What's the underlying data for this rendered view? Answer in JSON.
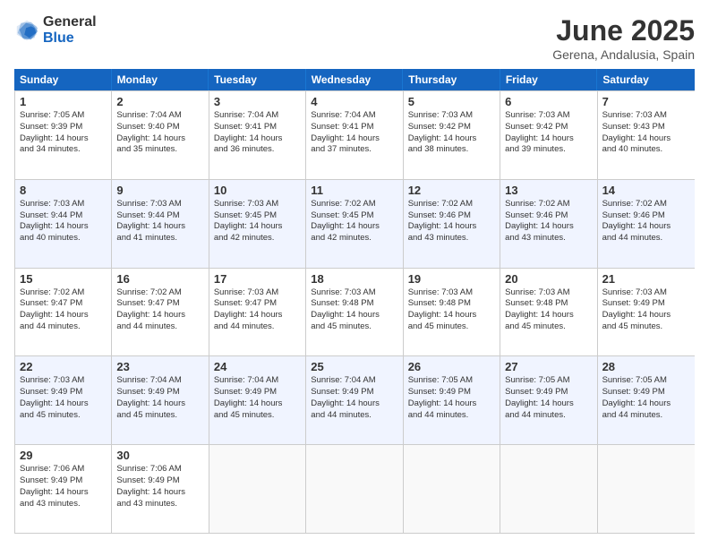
{
  "logo": {
    "general": "General",
    "blue": "Blue"
  },
  "title": "June 2025",
  "subtitle": "Gerena, Andalusia, Spain",
  "headers": [
    "Sunday",
    "Monday",
    "Tuesday",
    "Wednesday",
    "Thursday",
    "Friday",
    "Saturday"
  ],
  "rows": [
    [
      {
        "day": "",
        "empty": true
      },
      {
        "day": "",
        "empty": true
      },
      {
        "day": "",
        "empty": true
      },
      {
        "day": "",
        "empty": true
      },
      {
        "day": "",
        "empty": true
      },
      {
        "day": "",
        "empty": true
      },
      {
        "day": "",
        "empty": true
      }
    ],
    [
      {
        "day": "1",
        "lines": [
          "Sunrise: 7:05 AM",
          "Sunset: 9:39 PM",
          "Daylight: 14 hours",
          "and 34 minutes."
        ]
      },
      {
        "day": "2",
        "lines": [
          "Sunrise: 7:04 AM",
          "Sunset: 9:40 PM",
          "Daylight: 14 hours",
          "and 35 minutes."
        ]
      },
      {
        "day": "3",
        "lines": [
          "Sunrise: 7:04 AM",
          "Sunset: 9:41 PM",
          "Daylight: 14 hours",
          "and 36 minutes."
        ]
      },
      {
        "day": "4",
        "lines": [
          "Sunrise: 7:04 AM",
          "Sunset: 9:41 PM",
          "Daylight: 14 hours",
          "and 37 minutes."
        ]
      },
      {
        "day": "5",
        "lines": [
          "Sunrise: 7:03 AM",
          "Sunset: 9:42 PM",
          "Daylight: 14 hours",
          "and 38 minutes."
        ]
      },
      {
        "day": "6",
        "lines": [
          "Sunrise: 7:03 AM",
          "Sunset: 9:42 PM",
          "Daylight: 14 hours",
          "and 39 minutes."
        ]
      },
      {
        "day": "7",
        "lines": [
          "Sunrise: 7:03 AM",
          "Sunset: 9:43 PM",
          "Daylight: 14 hours",
          "and 40 minutes."
        ]
      }
    ],
    [
      {
        "day": "8",
        "lines": [
          "Sunrise: 7:03 AM",
          "Sunset: 9:44 PM",
          "Daylight: 14 hours",
          "and 40 minutes."
        ]
      },
      {
        "day": "9",
        "lines": [
          "Sunrise: 7:03 AM",
          "Sunset: 9:44 PM",
          "Daylight: 14 hours",
          "and 41 minutes."
        ]
      },
      {
        "day": "10",
        "lines": [
          "Sunrise: 7:03 AM",
          "Sunset: 9:45 PM",
          "Daylight: 14 hours",
          "and 42 minutes."
        ]
      },
      {
        "day": "11",
        "lines": [
          "Sunrise: 7:02 AM",
          "Sunset: 9:45 PM",
          "Daylight: 14 hours",
          "and 42 minutes."
        ]
      },
      {
        "day": "12",
        "lines": [
          "Sunrise: 7:02 AM",
          "Sunset: 9:46 PM",
          "Daylight: 14 hours",
          "and 43 minutes."
        ]
      },
      {
        "day": "13",
        "lines": [
          "Sunrise: 7:02 AM",
          "Sunset: 9:46 PM",
          "Daylight: 14 hours",
          "and 43 minutes."
        ]
      },
      {
        "day": "14",
        "lines": [
          "Sunrise: 7:02 AM",
          "Sunset: 9:46 PM",
          "Daylight: 14 hours",
          "and 44 minutes."
        ]
      }
    ],
    [
      {
        "day": "15",
        "lines": [
          "Sunrise: 7:02 AM",
          "Sunset: 9:47 PM",
          "Daylight: 14 hours",
          "and 44 minutes."
        ]
      },
      {
        "day": "16",
        "lines": [
          "Sunrise: 7:02 AM",
          "Sunset: 9:47 PM",
          "Daylight: 14 hours",
          "and 44 minutes."
        ]
      },
      {
        "day": "17",
        "lines": [
          "Sunrise: 7:03 AM",
          "Sunset: 9:47 PM",
          "Daylight: 14 hours",
          "and 44 minutes."
        ]
      },
      {
        "day": "18",
        "lines": [
          "Sunrise: 7:03 AM",
          "Sunset: 9:48 PM",
          "Daylight: 14 hours",
          "and 45 minutes."
        ]
      },
      {
        "day": "19",
        "lines": [
          "Sunrise: 7:03 AM",
          "Sunset: 9:48 PM",
          "Daylight: 14 hours",
          "and 45 minutes."
        ]
      },
      {
        "day": "20",
        "lines": [
          "Sunrise: 7:03 AM",
          "Sunset: 9:48 PM",
          "Daylight: 14 hours",
          "and 45 minutes."
        ]
      },
      {
        "day": "21",
        "lines": [
          "Sunrise: 7:03 AM",
          "Sunset: 9:49 PM",
          "Daylight: 14 hours",
          "and 45 minutes."
        ]
      }
    ],
    [
      {
        "day": "22",
        "lines": [
          "Sunrise: 7:03 AM",
          "Sunset: 9:49 PM",
          "Daylight: 14 hours",
          "and 45 minutes."
        ]
      },
      {
        "day": "23",
        "lines": [
          "Sunrise: 7:04 AM",
          "Sunset: 9:49 PM",
          "Daylight: 14 hours",
          "and 45 minutes."
        ]
      },
      {
        "day": "24",
        "lines": [
          "Sunrise: 7:04 AM",
          "Sunset: 9:49 PM",
          "Daylight: 14 hours",
          "and 45 minutes."
        ]
      },
      {
        "day": "25",
        "lines": [
          "Sunrise: 7:04 AM",
          "Sunset: 9:49 PM",
          "Daylight: 14 hours",
          "and 44 minutes."
        ]
      },
      {
        "day": "26",
        "lines": [
          "Sunrise: 7:05 AM",
          "Sunset: 9:49 PM",
          "Daylight: 14 hours",
          "and 44 minutes."
        ]
      },
      {
        "day": "27",
        "lines": [
          "Sunrise: 7:05 AM",
          "Sunset: 9:49 PM",
          "Daylight: 14 hours",
          "and 44 minutes."
        ]
      },
      {
        "day": "28",
        "lines": [
          "Sunrise: 7:05 AM",
          "Sunset: 9:49 PM",
          "Daylight: 14 hours",
          "and 44 minutes."
        ]
      }
    ],
    [
      {
        "day": "29",
        "lines": [
          "Sunrise: 7:06 AM",
          "Sunset: 9:49 PM",
          "Daylight: 14 hours",
          "and 43 minutes."
        ]
      },
      {
        "day": "30",
        "lines": [
          "Sunrise: 7:06 AM",
          "Sunset: 9:49 PM",
          "Daylight: 14 hours",
          "and 43 minutes."
        ]
      },
      {
        "day": "",
        "empty": true
      },
      {
        "day": "",
        "empty": true
      },
      {
        "day": "",
        "empty": true
      },
      {
        "day": "",
        "empty": true
      },
      {
        "day": "",
        "empty": true
      }
    ]
  ]
}
